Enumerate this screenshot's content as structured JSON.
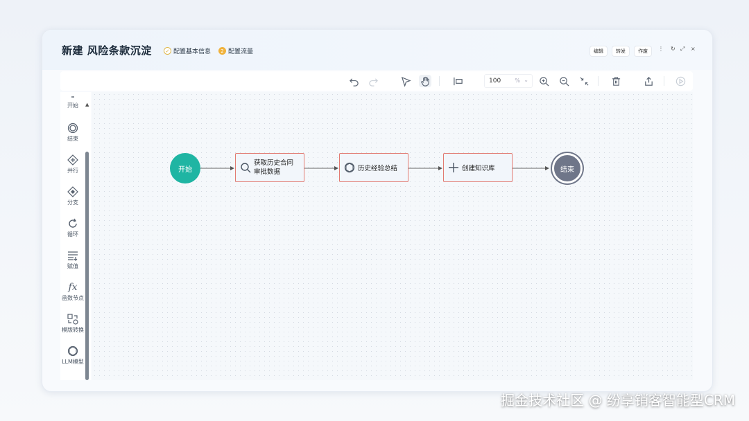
{
  "header": {
    "title": "新建  风险条款沉淀",
    "steps": [
      {
        "label": "配置基本信息",
        "icon": "check-circle-icon"
      },
      {
        "label": "配置流量",
        "icon": "number-2-icon"
      }
    ],
    "buttons": [
      {
        "label": "编辑"
      },
      {
        "label": "转发"
      },
      {
        "label": "作废"
      }
    ],
    "window_controls": [
      {
        "label": "⋮",
        "icon": "more-icon"
      },
      {
        "label": "↻",
        "icon": "refresh-icon"
      },
      {
        "label": "⤢",
        "icon": "expand-icon"
      },
      {
        "label": "×",
        "icon": "close-icon"
      }
    ]
  },
  "toolbar": {
    "zoom_value": "100",
    "zoom_unit": "%",
    "icons": [
      "undo-icon",
      "redo-icon",
      "pointer-icon",
      "hand-icon",
      "align-left-icon",
      "zoom-in-icon",
      "zoom-out-icon",
      "fit-icon",
      "delete-icon",
      "export-icon",
      "run-icon"
    ]
  },
  "sidebar": {
    "items": [
      {
        "label": "开始",
        "icon": "start-icon"
      },
      {
        "label": "结束",
        "icon": "end-circle-icon"
      },
      {
        "label": "并行",
        "icon": "parallel-icon"
      },
      {
        "label": "分支",
        "icon": "branch-icon"
      },
      {
        "label": "循环",
        "icon": "loop-icon"
      },
      {
        "label": "赋值",
        "icon": "assign-icon"
      },
      {
        "label": "函数节点",
        "icon": "function-icon"
      },
      {
        "label": "模版转换",
        "icon": "template-convert-icon"
      },
      {
        "label": "LLM模型",
        "icon": "llm-icon"
      }
    ]
  },
  "flow": {
    "start_label": "开始",
    "end_label": "结束",
    "nodes": [
      {
        "line1": "获取历史合同",
        "line2": "审批数据",
        "icon": "search-icon"
      },
      {
        "line1": "历史经验总结",
        "line2": "",
        "icon": "llm-icon"
      },
      {
        "line1": "创建知识库",
        "line2": "",
        "icon": "plus-icon"
      }
    ]
  },
  "watermark": "掘金技术社区 @ 纷享销客智能型CRM",
  "colors": {
    "start_node": "#1fb5a3",
    "end_node": "#6f7689",
    "node_border": "#e27a72",
    "step_done": "#e0b84a",
    "step_active": "#f0b23c"
  }
}
